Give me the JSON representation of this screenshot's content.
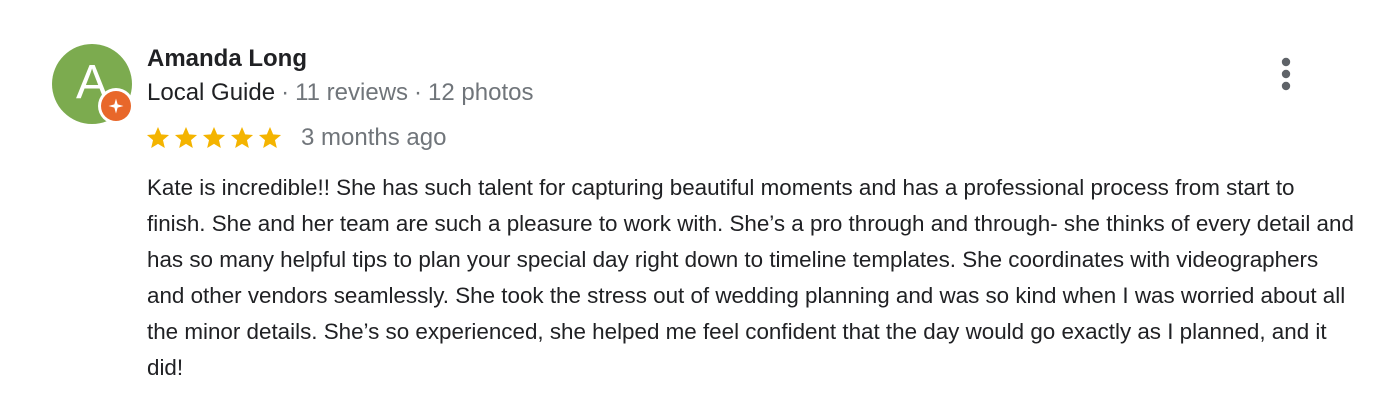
{
  "review": {
    "author": {
      "name": "Amanda Long",
      "avatar_letter": "A",
      "avatar_color": "#7cab4f",
      "badge_color": "#e8672a",
      "guide_label": "Local Guide",
      "reviews": "11 reviews",
      "photos": "12 photos",
      "separator": "·"
    },
    "rating": {
      "stars": 5,
      "max_stars": 5,
      "star_color": "#f4b400",
      "time": "3 months ago"
    },
    "text": "Kate is incredible!! She has such talent for capturing beautiful moments and has a professional process from start to finish. She and her team are such a pleasure to work with. She’s a pro through and through- she thinks of every detail and has so many helpful tips to plan your special day right down to timeline templates. She coordinates with videographers and other vendors seamlessly. She took the stress out of wedding planning and was so kind when I was worried about all the minor details. She’s so experienced, she helped me feel confident that the day would go exactly as I planned, and it did!",
    "menu_icon": "more-vert-icon"
  }
}
